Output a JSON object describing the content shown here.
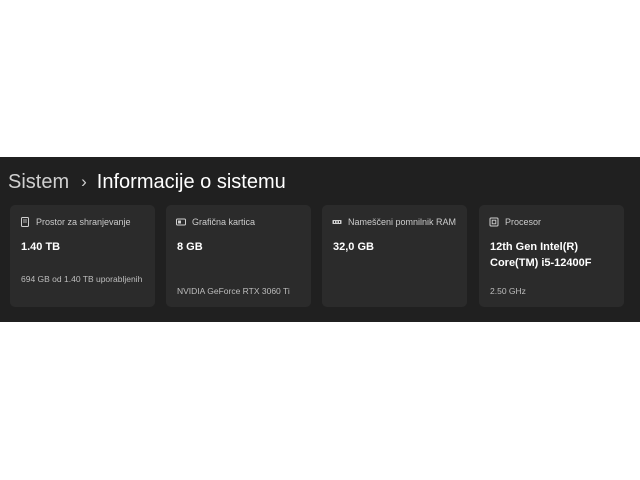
{
  "breadcrumb": {
    "parent": "Sistem",
    "separator": "›",
    "current": "Informacije o sistemu"
  },
  "cards": [
    {
      "icon": "storage-icon",
      "title": "Prostor za shranjevanje",
      "value": "1.40 TB",
      "sub": "694 GB od 1.40 TB uporabljenih"
    },
    {
      "icon": "graphics-card-icon",
      "title": "Grafična kartica",
      "value": "8 GB",
      "sub": "NVIDIA GeForce RTX 3060 Ti"
    },
    {
      "icon": "memory-icon",
      "title": "Nameščeni pomnilnik RAM",
      "value": "32,0 GB",
      "sub": ""
    },
    {
      "icon": "processor-icon",
      "title": "Procesor",
      "value": "12th Gen Intel(R) Core(TM) i5-12400F",
      "sub": "2.50 GHz"
    }
  ],
  "colors": {
    "panel_bg": "#202020",
    "card_bg": "#2b2b2b",
    "text_primary": "#ffffff",
    "text_secondary": "#cccccc"
  }
}
